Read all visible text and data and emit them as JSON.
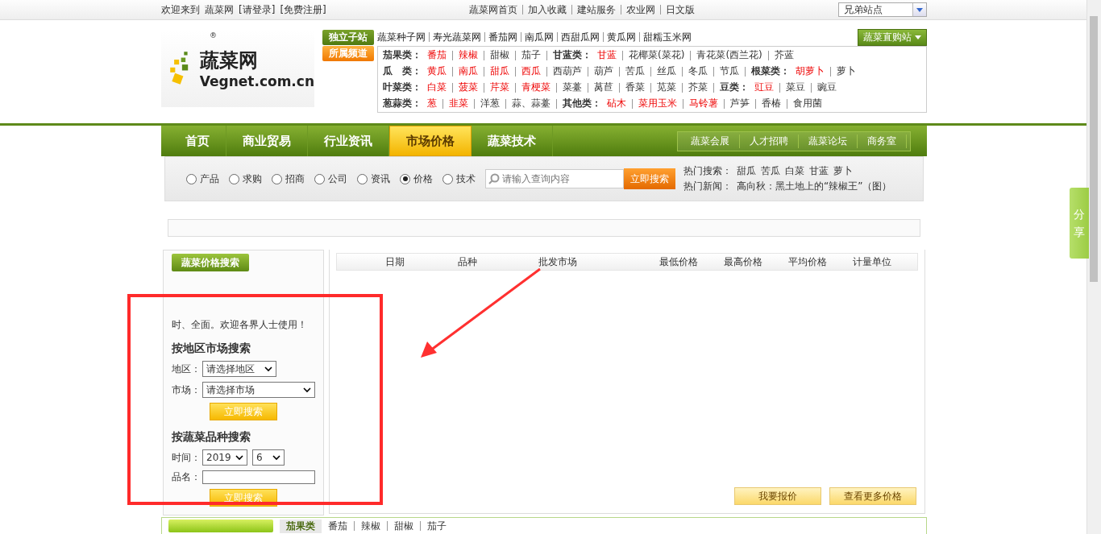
{
  "top_bar": {
    "welcome": "欢迎来到",
    "site": "蔬菜网",
    "login": "[请登录]",
    "register": "[免费注册]",
    "links": [
      "蔬菜网首页",
      "加入收藏",
      "建站服务",
      "农业网",
      "日文版"
    ],
    "sister_sites": "兄弟站点"
  },
  "logo": {
    "name": "蔬菜网",
    "domain": "Vegnet.com.cn",
    "mark": "®"
  },
  "sub_sites": {
    "label": "独立子站",
    "links": [
      "蔬菜种子网",
      "寿光蔬菜网",
      "番茄网",
      "南瓜网",
      "西甜瓜网",
      "黄瓜网",
      "甜糯玉米网"
    ],
    "shop": "蔬菜直购站"
  },
  "channels": {
    "label": "所属频道",
    "rows": [
      [
        {
          "name": "茄果类：",
          "items": [
            {
              "text": "番茄",
              "hot": true
            },
            {
              "text": "辣椒",
              "hot": true
            },
            {
              "text": "甜椒",
              "hot": false
            },
            {
              "text": "茄子",
              "hot": false
            }
          ]
        },
        {
          "name": "甘蓝类：",
          "items": [
            {
              "text": "甘蓝",
              "hot": true
            },
            {
              "text": "花椰菜(菜花)",
              "hot": false
            },
            {
              "text": "青花菜(西兰花)",
              "hot": false
            },
            {
              "text": "芥蓝",
              "hot": false
            }
          ]
        }
      ],
      [
        {
          "name": "瓜　类：",
          "items": [
            {
              "text": "黄瓜",
              "hot": true
            },
            {
              "text": "南瓜",
              "hot": true
            },
            {
              "text": "甜瓜",
              "hot": true
            },
            {
              "text": "西瓜",
              "hot": true
            },
            {
              "text": "西葫芦",
              "hot": false
            },
            {
              "text": "葫芦",
              "hot": false
            },
            {
              "text": "苦瓜",
              "hot": false
            },
            {
              "text": "丝瓜",
              "hot": false
            },
            {
              "text": "冬瓜",
              "hot": false
            },
            {
              "text": "节瓜",
              "hot": false
            }
          ]
        },
        {
          "name": "根菜类：",
          "items": [
            {
              "text": "胡萝卜",
              "hot": true
            },
            {
              "text": "萝卜",
              "hot": false
            }
          ]
        }
      ],
      [
        {
          "name": "叶菜类：",
          "items": [
            {
              "text": "白菜",
              "hot": true
            },
            {
              "text": "菠菜",
              "hot": true
            },
            {
              "text": "芹菜",
              "hot": true
            },
            {
              "text": "青梗菜",
              "hot": true
            },
            {
              "text": "菜薹",
              "hot": false
            },
            {
              "text": "莴苣",
              "hot": false
            },
            {
              "text": "香菜",
              "hot": false
            },
            {
              "text": "苋菜",
              "hot": false
            },
            {
              "text": "芥菜",
              "hot": false
            }
          ]
        },
        {
          "name": "豆类：",
          "items": [
            {
              "text": "豇豆",
              "hot": true
            },
            {
              "text": "菜豆",
              "hot": false
            },
            {
              "text": "豌豆",
              "hot": false
            }
          ]
        }
      ],
      [
        {
          "name": "葱蒜类：",
          "items": [
            {
              "text": "葱",
              "hot": true
            },
            {
              "text": "韭菜",
              "hot": true
            },
            {
              "text": "洋葱",
              "hot": false
            },
            {
              "text": "蒜、蒜薹",
              "hot": false
            }
          ]
        },
        {
          "name": "其他类：",
          "items": [
            {
              "text": "砧木",
              "hot": true
            },
            {
              "text": "菜用玉米",
              "hot": true
            },
            {
              "text": "马铃薯",
              "hot": true
            },
            {
              "text": "芦笋",
              "hot": false
            },
            {
              "text": "香椿",
              "hot": false
            },
            {
              "text": "食用菌",
              "hot": false
            }
          ]
        }
      ]
    ]
  },
  "nav": {
    "items": [
      {
        "label": "首页",
        "selected": false
      },
      {
        "label": "商业贸易",
        "selected": false
      },
      {
        "label": "行业资讯",
        "selected": false
      },
      {
        "label": "市场价格",
        "selected": true
      },
      {
        "label": "蔬菜技术",
        "selected": false
      }
    ],
    "side_links": [
      "蔬菜会展",
      "人才招聘",
      "蔬菜论坛",
      "商务室"
    ]
  },
  "search": {
    "options": [
      {
        "label": "产品",
        "selected": false
      },
      {
        "label": "求购",
        "selected": false
      },
      {
        "label": "招商",
        "selected": false
      },
      {
        "label": "公司",
        "selected": false
      },
      {
        "label": "资讯",
        "selected": false
      },
      {
        "label": "价格",
        "selected": true
      },
      {
        "label": "技术",
        "selected": false
      }
    ],
    "placeholder": "请输入查询内容",
    "button": "立即搜索",
    "hot_label": "热门搜索：",
    "hot": [
      "甜瓜",
      "苦瓜",
      "白菜",
      "甘蓝",
      "萝卜"
    ],
    "news_label": "热门新闻：",
    "news": "高向秋：黑土地上的“辣椒王”（图）"
  },
  "share": "分享",
  "sidebar": {
    "tab": "蔬菜价格搜索",
    "intro": "时、全面。欢迎各界人士使用！",
    "region": {
      "title": "按地区市场搜索",
      "fields": [
        {
          "label": "地区：",
          "value": "请选择地区"
        },
        {
          "label": "市场：",
          "value": "请选择市场"
        }
      ],
      "button": "立即搜索"
    },
    "variety": {
      "title": "按蔬菜品种搜索",
      "time_label": "时间：",
      "year": "2019",
      "month": "6",
      "name_label": "品名：",
      "button": "立即搜索"
    }
  },
  "table": {
    "columns": [
      "日期",
      "品种",
      "批发市场",
      "最低价格",
      "最高价格",
      "平均价格",
      "计量单位"
    ]
  },
  "actions": [
    "我要报价",
    "查看更多价格"
  ],
  "bottom_strip": {
    "label": "茄果类",
    "items": [
      "番茄",
      "辣椒",
      "甜椒",
      "茄子"
    ]
  }
}
